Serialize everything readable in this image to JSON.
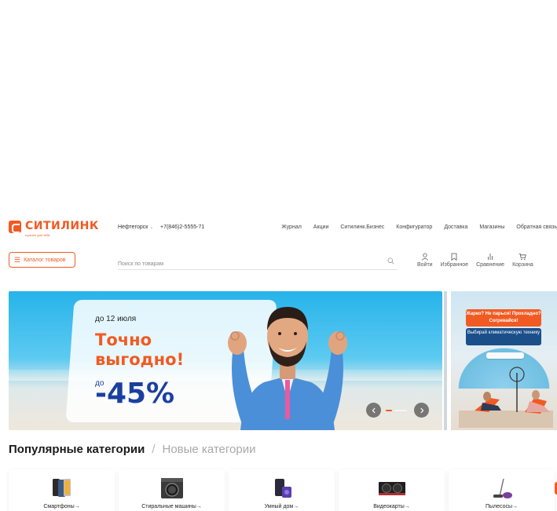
{
  "header": {
    "logo": {
      "name": "СИТИЛИНК",
      "slogan": "лучшее для тебя"
    },
    "city": "Нефтегорск",
    "phone": "+7(846)2-5555-71",
    "nav": [
      "Журнал",
      "Акции",
      "Ситилинк.Бизнес",
      "Конфигуратор",
      "Доставка",
      "Магазины",
      "Обратная связь"
    ]
  },
  "toolbar": {
    "catalog_label": "Каталог товаров",
    "search_placeholder": "Поиск по товарам",
    "actions": [
      "Войти",
      "Избранное",
      "Сравнение",
      "Корзина"
    ]
  },
  "banner": {
    "date": "до 12 июля",
    "title": "Точно выгодно!",
    "upto": "до",
    "discount": "-45%"
  },
  "side_banner": {
    "red_text": "Жарко? Не парься! Прохладно? Согревайся!",
    "blue_text": "Выбирай климатическую технику"
  },
  "categories": {
    "active_tab": "Популярные категории",
    "separator": "/",
    "other_tab": "Новые категории",
    "items": [
      "Смартфоны→",
      "Стиральные машины→",
      "Умный дом→",
      "Видеокарты→",
      "Пылесосы→"
    ]
  },
  "colors": {
    "accent": "#f15a22",
    "promo_blue": "#1b3fa0",
    "sky": "#27b3ea"
  },
  "icons": [
    "catalog-menu-icon",
    "search-icon",
    "user-icon",
    "bookmark-icon",
    "compare-icon",
    "cart-icon",
    "chevron-left-icon",
    "chevron-right-icon"
  ]
}
